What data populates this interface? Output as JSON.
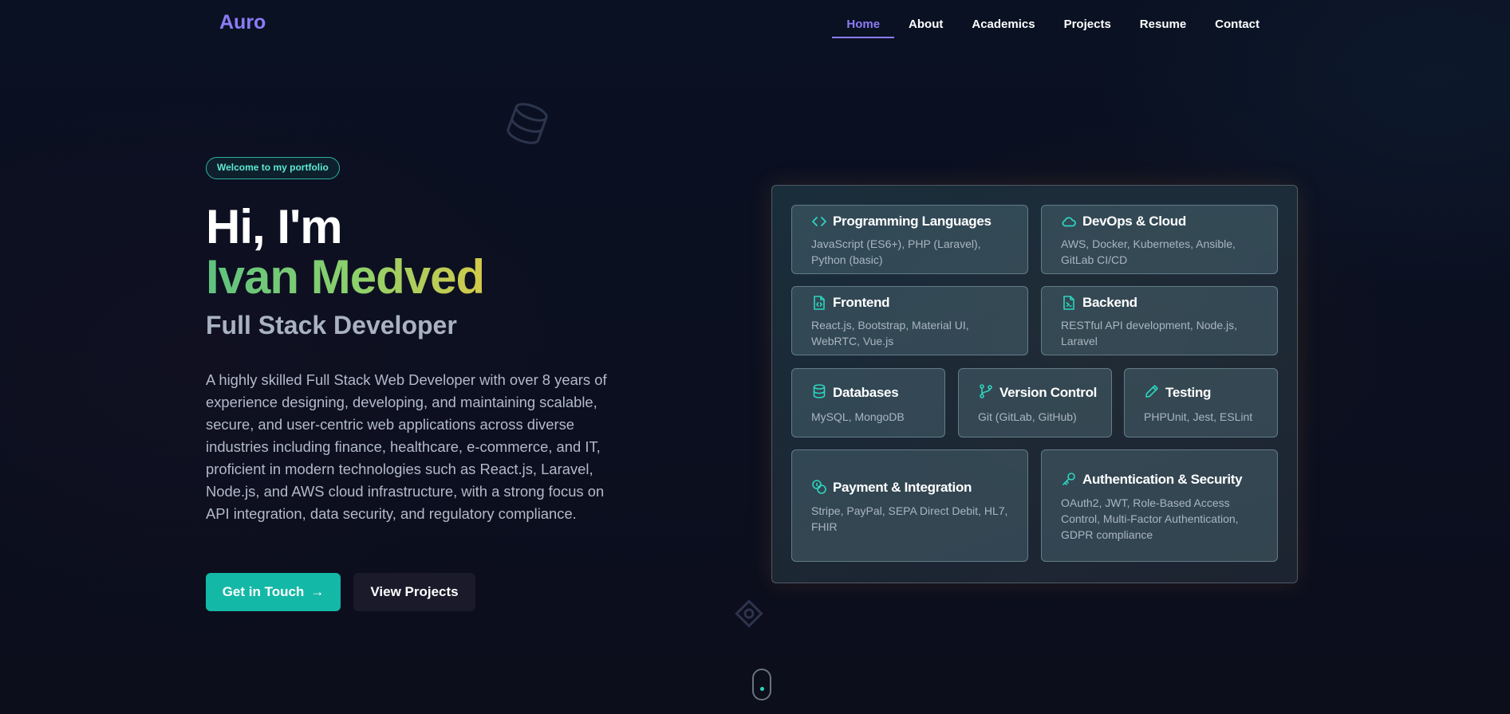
{
  "nav": {
    "logo": "Auro",
    "links": [
      "Home",
      "About",
      "Academics",
      "Projects",
      "Resume",
      "Contact"
    ],
    "active": "Home"
  },
  "hero": {
    "badge": "Welcome to my portfolio",
    "greeting": "Hi, I'm",
    "name": "Ivan Medved",
    "role": "Full Stack Developer",
    "description": "A highly skilled Full Stack Web Developer with over 8 years of experience designing, developing, and maintaining scalable, secure, and user-centric web applications across diverse industries including finance, healthcare, e-commerce, and IT, proficient in modern technologies such as React.js, Laravel, Node.js, and AWS cloud infrastructure, with a strong focus on API integration, data security, and regulatory compliance.",
    "primary_button": "Get in Touch",
    "secondary_button": "View Projects"
  },
  "skills": [
    {
      "title": "Programming Languages",
      "text": "JavaScript (ES6+), PHP (Laravel), Python (basic)",
      "icon": "code-icon"
    },
    {
      "title": "DevOps & Cloud",
      "text": "AWS, Docker, Kubernetes, Ansible, GitLab CI/CD",
      "icon": "cloud-icon"
    },
    {
      "title": "Frontend",
      "text": "React.js, Bootstrap, Material UI, WebRTC, Vue.js",
      "icon": "file-code-icon"
    },
    {
      "title": "Backend",
      "text": "RESTful API development, Node.js, Laravel",
      "icon": "file-terminal-icon"
    },
    {
      "title": "Databases",
      "text": "MySQL, MongoDB",
      "icon": "database-icon"
    },
    {
      "title": "Version Control",
      "text": "Git (GitLab, GitHub)",
      "icon": "git-branch-icon"
    },
    {
      "title": "Testing",
      "text": "PHPUnit, Jest, ESLint",
      "icon": "pencil-icon"
    },
    {
      "title": "Payment & Integration",
      "text": "Stripe, PayPal, SEPA Direct Debit, HL7, FHIR",
      "icon": "coins-icon"
    },
    {
      "title": "Authentication & Security",
      "text": "OAuth2, JWT, Role-Based Access Control, Multi-Factor Authentication, GDPR compliance",
      "icon": "key-icon"
    }
  ],
  "colors": {
    "accent": "#8b7cf6",
    "teal": "#14b8a6",
    "background": "#0b1020"
  }
}
